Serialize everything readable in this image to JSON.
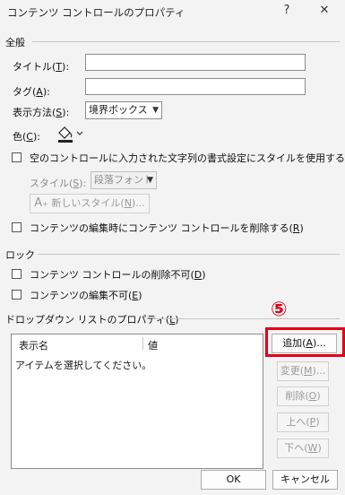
{
  "titlebar": {
    "title": "コンテンツ コントロールのプロパティ",
    "help_label": "?",
    "close_label": "✕"
  },
  "general": {
    "section_label": "全般",
    "title_label": "タイトル(",
    "title_key": "T",
    "title_suffix": "):",
    "title_value": "",
    "tag_label": "タグ(",
    "tag_key": "A",
    "tag_suffix": "):",
    "tag_value": "",
    "display_label": "表示方法(",
    "display_key": "S",
    "display_suffix": "):",
    "display_value": "境界ボックス",
    "color_label": "色(",
    "color_key": "C",
    "color_suffix": "):",
    "style_check_label": "空のコントロールに入力された文字列の書式設定にスタイルを使用する(",
    "style_check_key": "U",
    "style_check_suffix": ")",
    "style_label": "スタイル(",
    "style_key": "S",
    "style_suffix": "):",
    "style_value": "段落フォント",
    "new_style_prefix": "A",
    "new_style_label": "新しいスタイル(",
    "new_style_key": "N",
    "new_style_suffix": ")...",
    "remove_check_label": "コンテンツの編集時にコンテンツ コントロールを削除する(",
    "remove_check_key": "R",
    "remove_check_suffix": ")"
  },
  "lock": {
    "section_label": "ロック",
    "no_delete_label": "コンテンツ コントロールの削除不可(",
    "no_delete_key": "D",
    "no_delete_suffix": ")",
    "no_edit_label": "コンテンツの編集不可(",
    "no_edit_key": "E",
    "no_edit_suffix": ")"
  },
  "dropdown": {
    "section_label": "ドロップダウン リストのプロパティ(",
    "section_key": "L",
    "section_suffix": ")",
    "col_display": "表示名",
    "col_value": "値",
    "placeholder_row": "アイテムを選択してください。",
    "add_label": "追加(",
    "add_key": "A",
    "add_suffix": ")...",
    "modify_label": "変更(",
    "modify_key": "M",
    "modify_suffix": ")...",
    "delete_label": "削除(",
    "delete_key": "O",
    "delete_suffix": ")",
    "up_label": "上へ(",
    "up_key": "P",
    "up_suffix": ")",
    "down_label": "下へ(",
    "down_key": "W",
    "down_suffix": ")"
  },
  "annotation": {
    "step_marker": "⑤",
    "accent_color": "#e20016"
  },
  "footer": {
    "ok_label": "OK",
    "cancel_label": "キャンセル"
  }
}
